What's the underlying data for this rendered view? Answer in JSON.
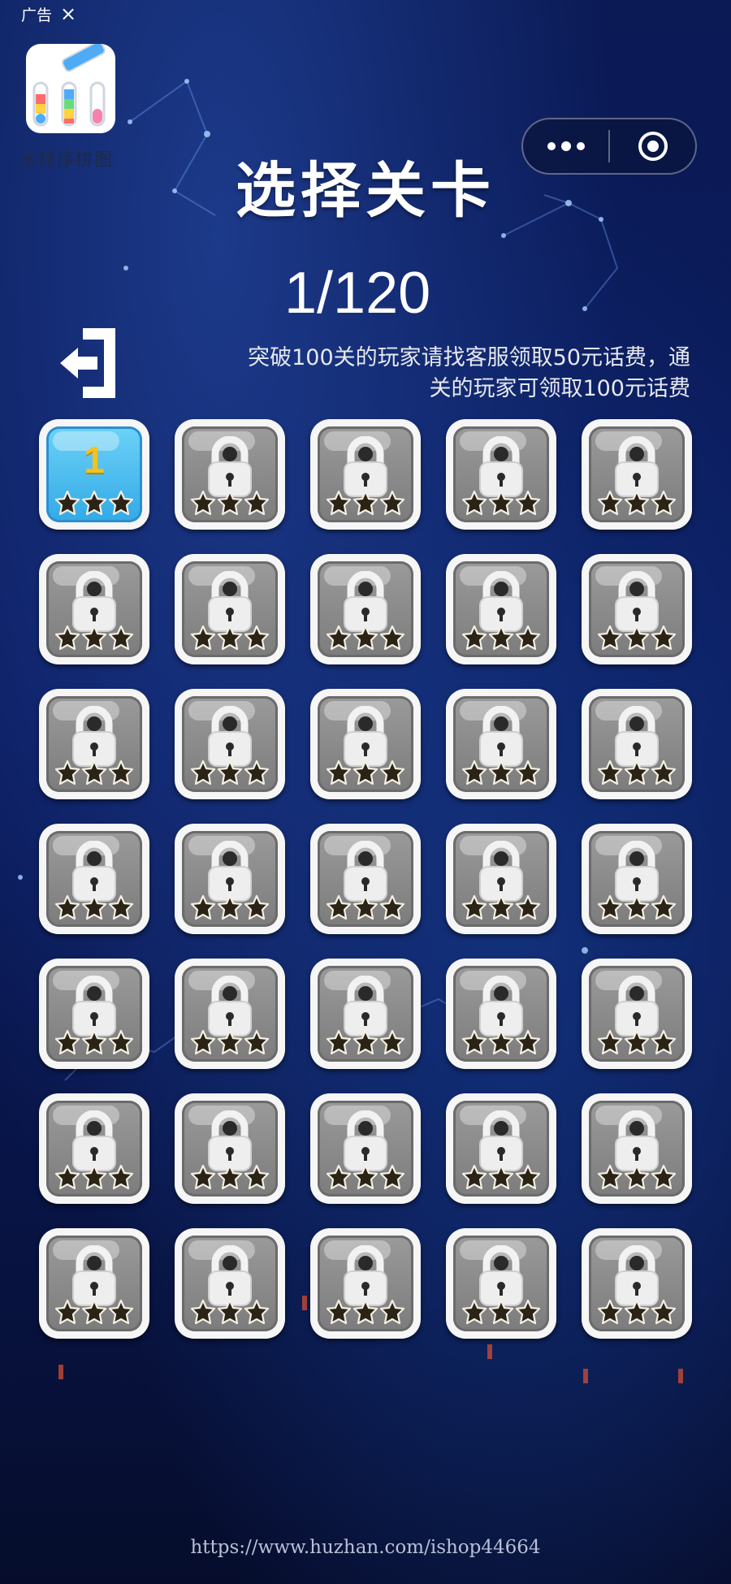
{
  "ad": {
    "label": "广告",
    "close": "×"
  },
  "app": {
    "name": "水排序拼图"
  },
  "screen": {
    "title": "选择关卡",
    "page_count": "1/120",
    "notice": "突破100关的玩家请找客服领取50元话费，通关的玩家可领取100元话费"
  },
  "levels": [
    {
      "number": "1",
      "locked": false
    },
    {
      "locked": true
    },
    {
      "locked": true
    },
    {
      "locked": true
    },
    {
      "locked": true
    },
    {
      "locked": true
    },
    {
      "locked": true
    },
    {
      "locked": true
    },
    {
      "locked": true
    },
    {
      "locked": true
    },
    {
      "locked": true
    },
    {
      "locked": true
    },
    {
      "locked": true
    },
    {
      "locked": true
    },
    {
      "locked": true
    },
    {
      "locked": true
    },
    {
      "locked": true
    },
    {
      "locked": true
    },
    {
      "locked": true
    },
    {
      "locked": true
    },
    {
      "locked": true
    },
    {
      "locked": true
    },
    {
      "locked": true
    },
    {
      "locked": true
    },
    {
      "locked": true
    },
    {
      "locked": true
    },
    {
      "locked": true
    },
    {
      "locked": true
    },
    {
      "locked": true
    },
    {
      "locked": true
    },
    {
      "locked": true
    },
    {
      "locked": true
    },
    {
      "locked": true
    },
    {
      "locked": true
    },
    {
      "locked": true
    }
  ],
  "watermark": "https://www.huzhan.com/ishop44664",
  "colors": {
    "tile_unlocked": "#33a9e6",
    "tile_locked": "#8a8a8a",
    "level_number": "#f2c21f",
    "star": "#2b2416"
  },
  "icons": [
    "more-dots-icon",
    "target-icon",
    "exit-icon",
    "lock-icon",
    "star-icon",
    "app-logo-icon"
  ]
}
